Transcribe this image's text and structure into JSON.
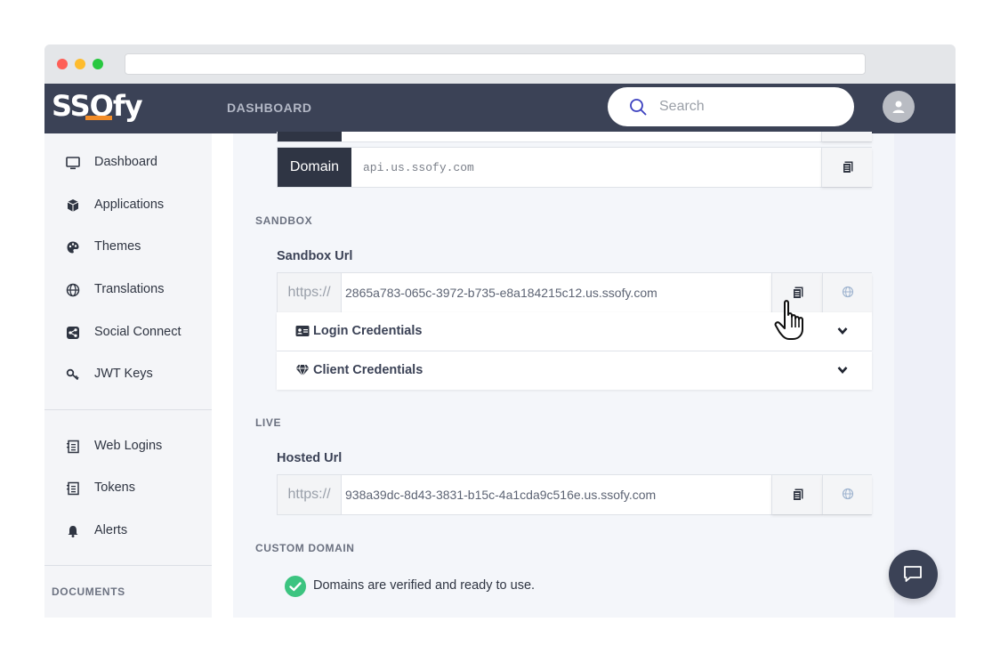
{
  "header": {
    "logo_text": "SSOfy",
    "nav_dashboard": "DASHBOARD",
    "search_placeholder": "Search"
  },
  "sidebar": {
    "items": [
      {
        "label": "Dashboard",
        "icon": "monitor-icon"
      },
      {
        "label": "Applications",
        "icon": "cube-icon"
      },
      {
        "label": "Themes",
        "icon": "palette-icon"
      },
      {
        "label": "Translations",
        "icon": "globe-icon"
      },
      {
        "label": "Social Connect",
        "icon": "share-icon"
      },
      {
        "label": "JWT Keys",
        "icon": "key-icon"
      }
    ],
    "items2": [
      {
        "label": "Web Logins",
        "icon": "list-icon"
      },
      {
        "label": "Tokens",
        "icon": "list-icon"
      },
      {
        "label": "Alerts",
        "icon": "bell-icon"
      }
    ],
    "documents_section": "DOCUMENTS"
  },
  "main": {
    "domain_tag": "Domain",
    "domain_value": "api.us.ssofy.com",
    "sandbox": {
      "section": "SANDBOX",
      "label": "Sandbox Url",
      "prefix": "https://",
      "value": "2865a783-065c-3972-b735-e8a184215c12.us.ssofy.com"
    },
    "accordions": [
      {
        "label": "Login Credentials",
        "icon": "id-card-icon"
      },
      {
        "label": "Client Credentials",
        "icon": "diamond-icon"
      }
    ],
    "live": {
      "section": "LIVE",
      "label": "Hosted Url",
      "prefix": "https://",
      "value": "938a39dc-8d43-3831-b15c-4a1cda9c516e.us.ssofy.com"
    },
    "custom_domain": {
      "section": "CUSTOM DOMAIN",
      "status_text": "Domains are verified and ready to use."
    }
  },
  "colors": {
    "header_bg": "#3b4256",
    "accent_orange": "#f28c28",
    "verified_green": "#3cc480"
  }
}
